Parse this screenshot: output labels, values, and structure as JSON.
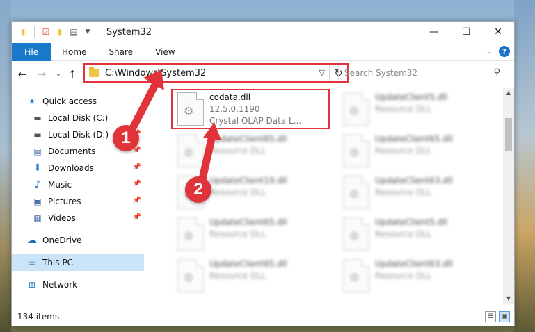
{
  "window": {
    "title": "System32"
  },
  "ribbon": {
    "tabs": [
      "File",
      "Home",
      "Share",
      "View"
    ]
  },
  "navbar": {
    "address": "C:\\Windows\\System32",
    "search_placeholder": "Search System32"
  },
  "sidebar": {
    "items": [
      {
        "label": "Quick access",
        "icon": "star-icon"
      },
      {
        "label": "Local Disk (C:)",
        "icon": "drive-icon"
      },
      {
        "label": "Local Disk (D:)",
        "icon": "drive-icon"
      },
      {
        "label": "Documents",
        "icon": "documents-icon"
      },
      {
        "label": "Downloads",
        "icon": "download-icon"
      },
      {
        "label": "Music",
        "icon": "music-icon"
      },
      {
        "label": "Pictures",
        "icon": "pictures-icon"
      },
      {
        "label": "Videos",
        "icon": "videos-icon"
      },
      {
        "label": "OneDrive",
        "icon": "cloud-icon"
      },
      {
        "label": "This PC",
        "icon": "computer-icon"
      },
      {
        "label": "Network",
        "icon": "network-icon"
      }
    ]
  },
  "files": [
    {
      "name": "codata.dll",
      "line2": "12.5.0.1190",
      "line3": "Crystal OLAP Data L..."
    },
    {
      "name": "UpdateClient5.dll",
      "line2": "Resource DLL"
    },
    {
      "name": "UpdateClient65.dll",
      "line2": "Resource DLL"
    },
    {
      "name": "UpdateClient65.dll",
      "line2": "Resource DLL"
    },
    {
      "name": "UpdateClient19.dll",
      "line2": "Resource DLL"
    },
    {
      "name": "UpdateClient63.dll",
      "line2": "Resource DLL"
    },
    {
      "name": "UpdateClient65.dll",
      "line2": "Resource DLL"
    },
    {
      "name": "UpdateClient5.dll",
      "line2": "Resource DLL"
    },
    {
      "name": "UpdateClient65.dll",
      "line2": "Resource DLL"
    },
    {
      "name": "UpdateClient63.dll",
      "line2": "Resource DLL"
    }
  ],
  "status": {
    "item_count": "134 items"
  },
  "annotations": {
    "step1": "1",
    "step2": "2"
  },
  "colors": {
    "accent": "#1979ca",
    "highlight": "#e0333a",
    "selected": "#cce4f7"
  }
}
